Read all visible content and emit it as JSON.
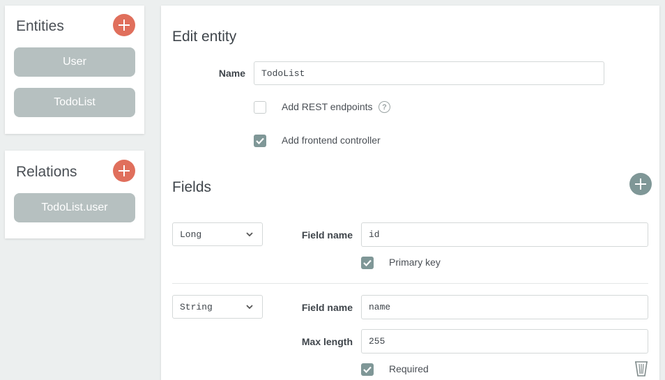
{
  "sidebar": {
    "entities": {
      "title": "Entities",
      "items": [
        {
          "label": "User"
        },
        {
          "label": "TodoList"
        }
      ]
    },
    "relations": {
      "title": "Relations",
      "items": [
        {
          "label": "TodoList.user"
        }
      ]
    }
  },
  "editor": {
    "title": "Edit entity",
    "name_label": "Name",
    "name_value": "TodoList",
    "rest_checkbox": {
      "label": "Add REST endpoints",
      "checked": false,
      "help_icon": "question-circle-icon"
    },
    "frontend_checkbox": {
      "label": "Add frontend controller",
      "checked": true
    },
    "fields_title": "Fields",
    "fields": [
      {
        "type": "Long",
        "field_name_label": "Field name",
        "field_name": "id",
        "checkbox": {
          "label": "Primary key",
          "checked": true
        }
      },
      {
        "type": "String",
        "field_name_label": "Field name",
        "field_name": "name",
        "max_length_label": "Max length",
        "max_length": "255",
        "checkbox": {
          "label": "Required",
          "checked": true
        }
      }
    ]
  },
  "colors": {
    "accent_red": "#e06f5c",
    "accent_grey": "#7f9797",
    "pill": "#b6c0c0",
    "background": "#ecefef"
  }
}
